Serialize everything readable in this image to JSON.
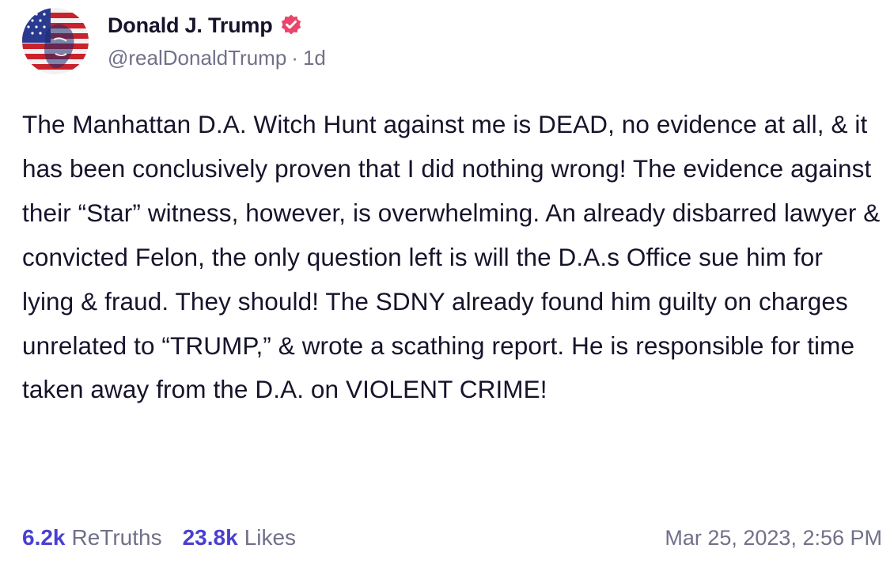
{
  "author": {
    "display_name": "Donald J. Trump",
    "handle": "@realDonaldTrump",
    "separator": "·",
    "relative_time": "1d",
    "avatar_icon": "flag-portrait-avatar",
    "verified_icon": "verified-badge-icon"
  },
  "post": {
    "text": "The Manhattan D.A. Witch Hunt against me is DEAD, no evidence at all, & it has been conclusively proven that I did nothing wrong! The evidence against their “Star” witness, however, is overwhelming. An already disbarred lawyer & convicted Felon, the only question left is will the D.A.s Office sue him for lying & fraud. They should! The SDNY already found him guilty on charges unrelated to “TRUMP,” & wrote a scathing report. He is responsible for time taken away from the D.A. on VIOLENT CRIME!"
  },
  "stats": {
    "retruths_count": "6.2k",
    "retruths_label": "ReTruths",
    "likes_count": "23.8k",
    "likes_label": "Likes"
  },
  "timestamp": "Mar 25, 2023, 2:56 PM",
  "colors": {
    "accent": "#4a3fd0",
    "verified_badge": "#e8466a",
    "muted_text": "#71708a",
    "body_text": "#16142b"
  }
}
